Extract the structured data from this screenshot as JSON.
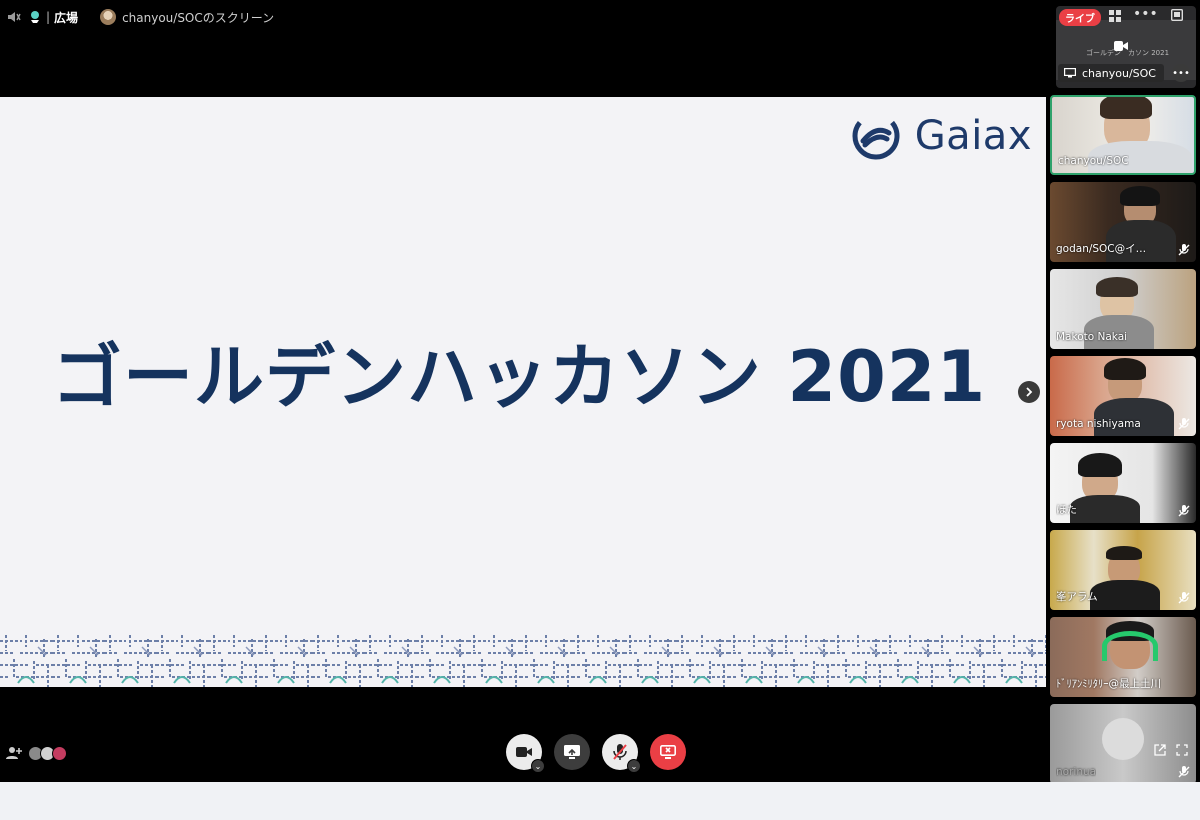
{
  "topbar": {
    "channel_name": "広場",
    "stream_title": "chanyou/SOCのスクリーン"
  },
  "slide": {
    "logo_text": "Gaiax",
    "heading": "ゴールデンハッカソン 2021"
  },
  "sidebar": {
    "live_label": "ライブ",
    "preview_label": "chanyou/SOC",
    "preview_mini_text": "ゴールデン　カソン 2021",
    "participants": [
      {
        "name": "chanyou/SOC",
        "muted": false,
        "active": true
      },
      {
        "name": "godan/SOC@イ…",
        "muted": true,
        "active": false
      },
      {
        "name": "Makoto Nakai",
        "muted": false,
        "active": false
      },
      {
        "name": "ryota nishiyama",
        "muted": true,
        "active": false
      },
      {
        "name": "ほた",
        "muted": true,
        "active": false
      },
      {
        "name": "峯アラム",
        "muted": true,
        "active": false
      },
      {
        "name": "ﾄﾞﾘｱﾝﾐﾘﾀﾘｰ@最上土川",
        "muted": false,
        "active": false
      },
      {
        "name": "norinua",
        "muted": true,
        "active": false
      }
    ]
  },
  "controls": {
    "camera": "camera",
    "screen_share": "screen-share",
    "mic": "mic-muted",
    "stop_share": "stop-share"
  },
  "colors": {
    "accent_green": "#2ea26b",
    "live_red": "#ea3f45",
    "slide_navy": "#15335e"
  }
}
